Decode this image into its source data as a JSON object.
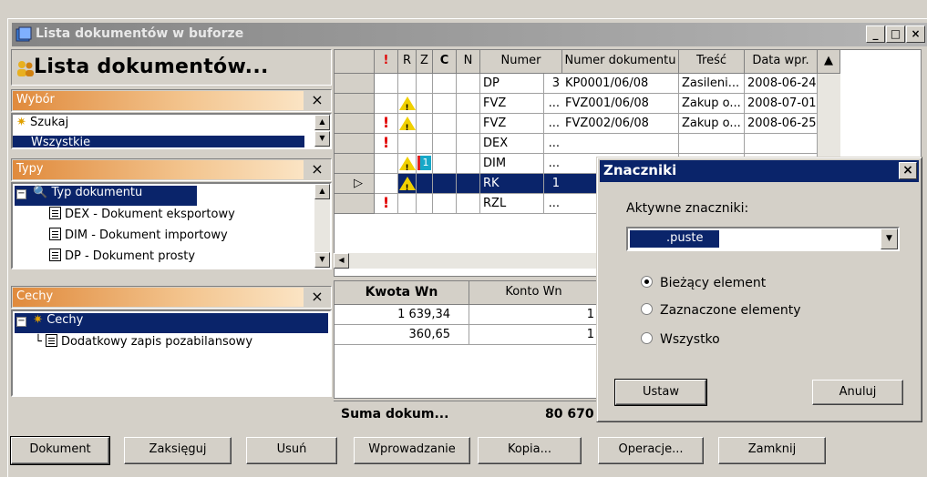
{
  "window": {
    "title": "Lista dokumentów w buforze",
    "controls": [
      "_",
      "□",
      "×"
    ]
  },
  "left": {
    "big_title": "Lista dokumentów...",
    "wybor": {
      "label": "Wybór",
      "items": [
        "Szukaj",
        "Wszystkie"
      ]
    },
    "typy": {
      "label": "Typy",
      "root": "Typ dokumentu",
      "items": [
        "DEX - Dokument eksportowy",
        "DIM - Dokument importowy",
        "DP - Dokument prosty"
      ]
    },
    "cechy": {
      "label": "Cechy",
      "root": "Cechy",
      "items": [
        "Dodatkowy zapis pozabilansowy"
      ]
    }
  },
  "grid": {
    "columns": [
      "!",
      "R",
      "Z",
      "C",
      "N",
      "Numer",
      "Numer dokumentu",
      "Treść",
      "Data wpr."
    ],
    "rows": [
      {
        "excl": false,
        "warn": false,
        "numer": "DP",
        "numer_suffix": "3",
        "doc": "KP0001/06/08",
        "tresc": "Zasileni...",
        "data": "2008-06-24"
      },
      {
        "excl": false,
        "warn": true,
        "numer": "FVZ",
        "numer_suffix": "...",
        "doc": "FVZ001/06/08",
        "tresc": "Zakup o...",
        "data": "2008-07-01"
      },
      {
        "excl": true,
        "warn": true,
        "numer": "FVZ",
        "numer_suffix": "...",
        "doc": "FVZ002/06/08",
        "tresc": "Zakup o...",
        "data": "2008-06-25"
      },
      {
        "excl": true,
        "warn": false,
        "numer": "DEX",
        "numer_suffix": "...",
        "doc": "",
        "tresc": "",
        "data": ""
      },
      {
        "excl": false,
        "warn": true,
        "numer": "DIM",
        "numer_suffix": "...",
        "doc": "",
        "tresc": "",
        "data": ""
      },
      {
        "excl": false,
        "warn": true,
        "numer": "RK",
        "numer_suffix": "1",
        "doc": "",
        "tresc": "",
        "data": ""
      },
      {
        "excl": true,
        "warn": false,
        "numer": "RZL",
        "numer_suffix": "...",
        "doc": "",
        "tresc": "",
        "data": ""
      }
    ],
    "row_marker": "▷",
    "badge": "1"
  },
  "bottom": {
    "col_kwota": "Kwota Wn",
    "col_konto": "Konto Wn",
    "rows": [
      {
        "kwota": "1 639,34",
        "konto": "1"
      },
      {
        "kwota": "360,65",
        "konto": "1"
      }
    ],
    "suma_label": "Suma dokum...",
    "suma_value": "80 670"
  },
  "dialog": {
    "title": "Znaczniki",
    "label": "Aktywne znaczniki:",
    "combo_value": ".puste",
    "options": [
      "Bieżący element",
      "Zaznaczone elementy",
      "Wszystko"
    ],
    "selected": 0,
    "ok": "Ustaw",
    "cancel": "Anuluj"
  },
  "buttons": [
    "Dokument",
    "Zaksięguj",
    "Usuń",
    "Wprowadzanie",
    "Kopia...",
    "Operacje...",
    "Zamknij"
  ]
}
